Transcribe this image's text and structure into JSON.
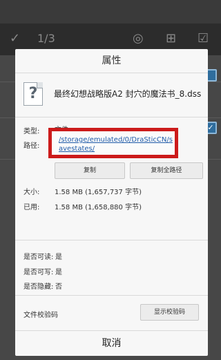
{
  "background": {
    "counter": "1/3",
    "check_icon": "check-icon",
    "compass_icon": "compass-icon",
    "move_icon": "move-icon",
    "select_all_icon": "select-all-icon"
  },
  "dialog": {
    "title": "属性",
    "file_icon": "unknown-file-icon",
    "file_icon_glyph": "?",
    "file_name": "最终幻想战略版A2 封穴的魔法书_8.dss",
    "type_label": "类型:",
    "type_value": "文件",
    "path_label": "路径:",
    "path_value": "/storage/emulated/0/DraSticCN/savestates/",
    "copy_button": "复制",
    "copy_full_path_button": "复制全路径",
    "size_label": "大小:",
    "size_value": "1.58 MB (1,657,737 字节)",
    "used_label": "已用:",
    "used_value": "1.58 MB (1,658,880 字节)",
    "readable_label": "是否可读:",
    "readable_value": "是",
    "writable_label": "是否可写:",
    "writable_value": "是",
    "hidden_label": "是否隐藏:",
    "hidden_value": "否",
    "checksum_label": "文件校验码",
    "show_checksum_button": "显示校验码",
    "cancel_button": "取消"
  },
  "colors": {
    "highlight_border": "#cc1b1b",
    "link": "#1e5aa8"
  }
}
